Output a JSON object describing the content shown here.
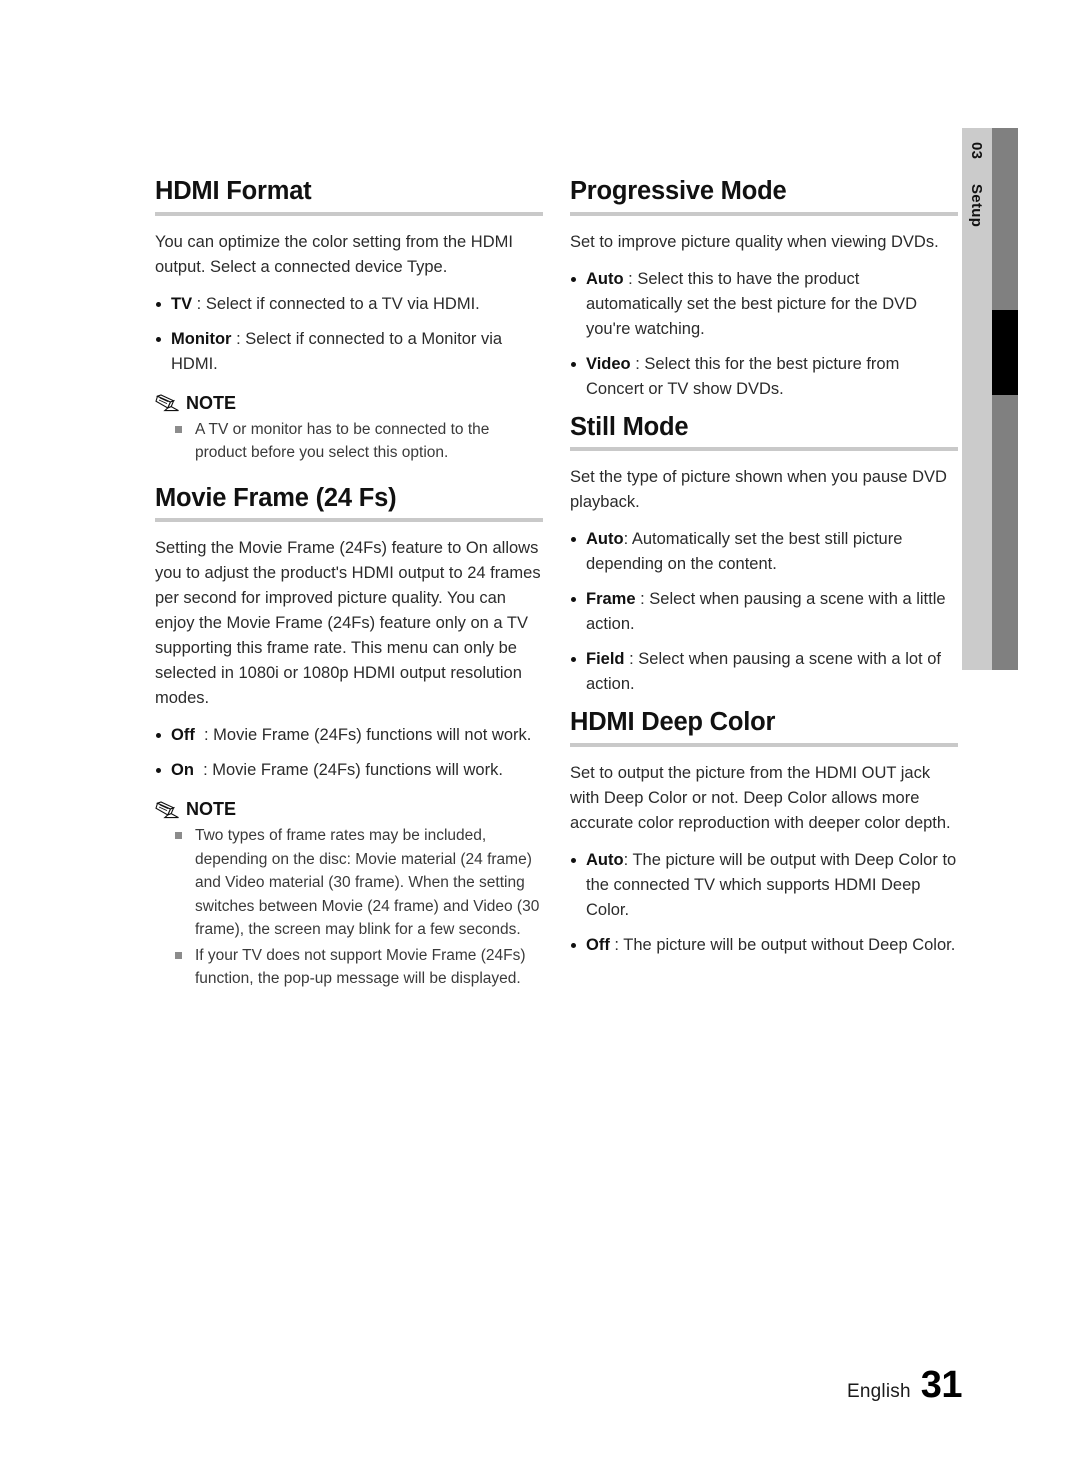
{
  "side_tab": {
    "chapter_number": "03",
    "chapter_name": "Setup",
    "colors": {
      "label_strip": "#cbcbcb",
      "rail": "#808080",
      "marker": "#000000"
    }
  },
  "footer": {
    "language": "English",
    "page_number": "31"
  },
  "note_label": "NOTE",
  "left_column": {
    "sections": [
      {
        "heading": "HDMI Format",
        "paragraphs": [
          "You can optimize the color setting from the HDMI output. Select a connected device Type."
        ],
        "bullets": [
          {
            "term": "TV",
            "sep": " : ",
            "text": "Select if connected to a TV via HDMI."
          },
          {
            "term": "Monitor",
            "sep": " : ",
            "text": "Select if connected to a Monitor via HDMI."
          }
        ],
        "note": {
          "label": "NOTE",
          "items": [
            "A TV or monitor has to be connected to the product before you select this option."
          ]
        }
      },
      {
        "heading": "Movie Frame (24 Fs)",
        "paragraphs": [
          "Setting the Movie Frame (24Fs) feature to On allows you to adjust the product's HDMI output to 24 frames per second for improved picture quality. You can enjoy the Movie Frame (24Fs) feature only on a TV supporting this frame rate. This menu can only be selected in 1080i or 1080p HDMI output resolution modes."
        ],
        "bullets": [
          {
            "term": "Off",
            "sep": "  : ",
            "text": "Movie Frame (24Fs) functions will not work."
          },
          {
            "term": "On",
            "sep": "  : ",
            "text": "Movie Frame (24Fs) functions will work."
          }
        ],
        "note": {
          "label": "NOTE",
          "items": [
            "Two types of frame rates may be included, depending on the disc: Movie material (24 frame) and Video material (30 frame). When the setting switches between Movie (24 frame) and Video (30 frame), the screen may blink for a few seconds.",
            "If your TV does not support Movie Frame (24Fs) function, the pop-up message will be displayed."
          ]
        }
      }
    ]
  },
  "right_column": {
    "sections": [
      {
        "heading": "Progressive Mode",
        "paragraphs": [
          "Set to improve picture quality when viewing DVDs."
        ],
        "bullets": [
          {
            "term": "Auto",
            "sep": " : ",
            "text": "Select this to have the product automatically set the best picture for the DVD you're watching."
          },
          {
            "term": "Video",
            "sep": " : ",
            "text": "Select this for the best picture from Concert or TV show DVDs."
          }
        ]
      },
      {
        "heading": "Still Mode",
        "paragraphs": [
          "Set the type of picture shown when you pause DVD playback."
        ],
        "bullets": [
          {
            "term": "Auto",
            "sep": ": ",
            "text": "Automatically set the best still picture depending on the content."
          },
          {
            "term": "Frame",
            "sep": " : ",
            "text": "Select when pausing a scene with a little action."
          },
          {
            "term": "Field",
            "sep": " : ",
            "text": "Select when pausing a scene with a lot of action."
          }
        ]
      },
      {
        "heading": "HDMI Deep Color",
        "paragraphs": [
          "Set to output the picture from the HDMI OUT jack with Deep Color or not. Deep Color allows more accurate color reproduction with deeper color depth."
        ],
        "bullets": [
          {
            "term": "Auto",
            "sep": ": ",
            "text": "The picture will be output with Deep Color to the connected TV which supports HDMI Deep Color."
          },
          {
            "term": "Off",
            "sep": " : ",
            "text": "The picture will be output without Deep Color."
          }
        ]
      }
    ]
  }
}
